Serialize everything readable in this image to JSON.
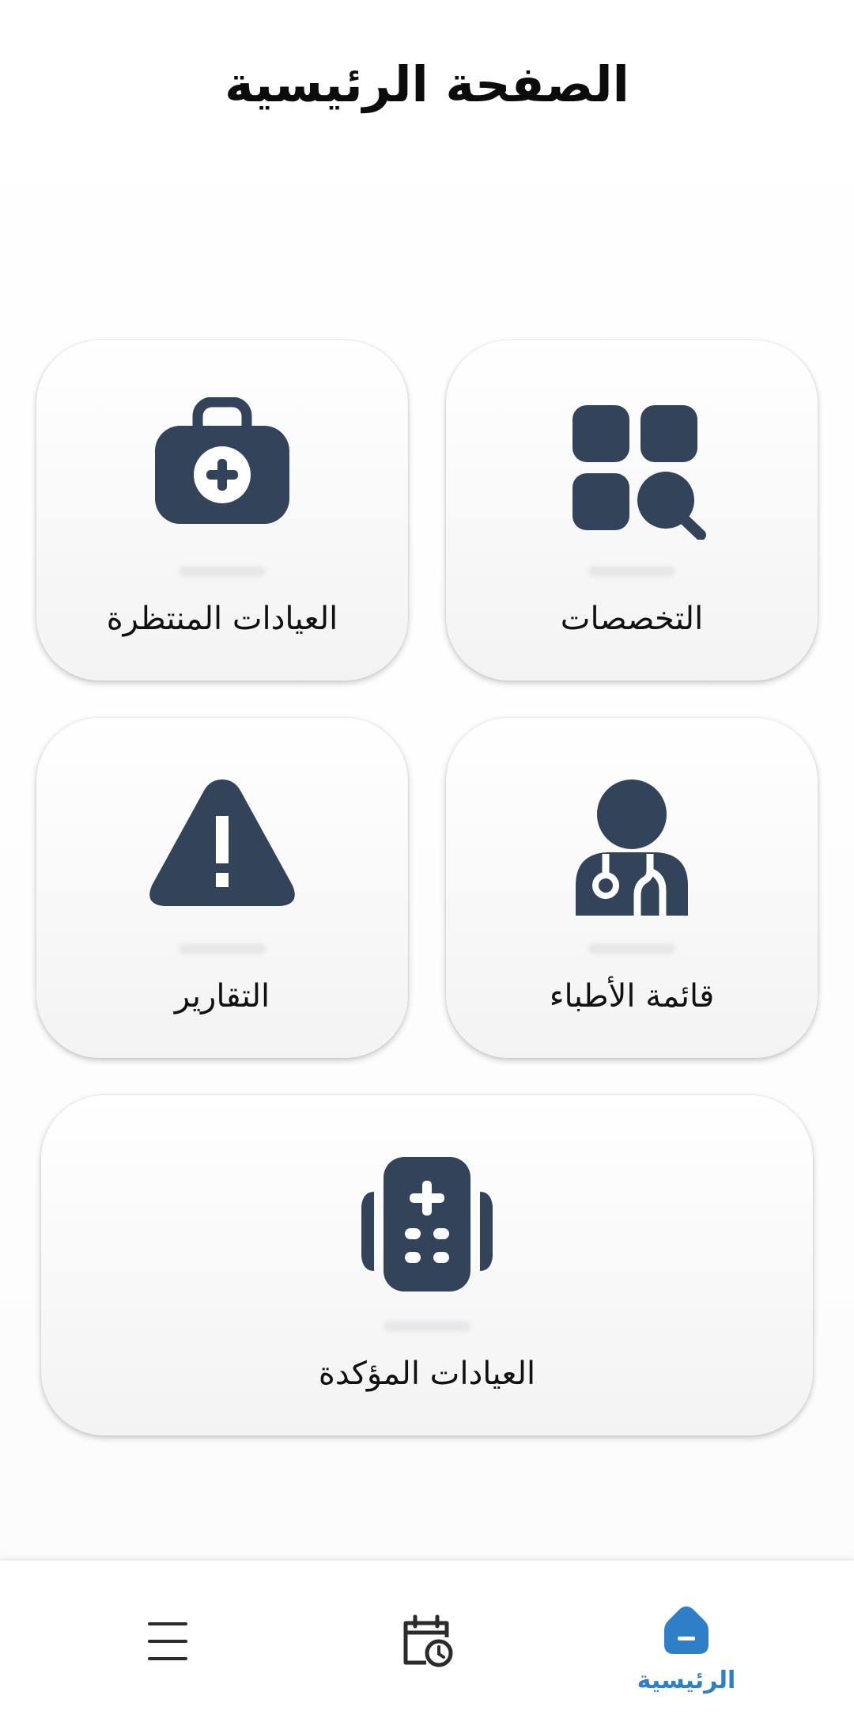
{
  "header": {
    "title": "الصفحة الرئيسية"
  },
  "cards": {
    "specialties": {
      "label": "التخصصات",
      "icon": "specialties-search-icon"
    },
    "pending_clinics": {
      "label": "العيادات المنتظرة",
      "icon": "medical-kit-icon"
    },
    "doctors_list": {
      "label": "قائمة الأطباء",
      "icon": "doctor-icon"
    },
    "reports": {
      "label": "التقارير",
      "icon": "warning-icon"
    },
    "confirmed_clinics": {
      "label": "العيادات المؤكدة",
      "icon": "medical-device-icon"
    }
  },
  "bottom_nav": {
    "items": [
      {
        "label": "",
        "icon": "menu-icon"
      },
      {
        "label": "",
        "icon": "calendar-clock-icon"
      },
      {
        "label": "الرئيسية",
        "icon": "home-icon",
        "active": true
      }
    ]
  },
  "colors": {
    "icon": "#33445a",
    "accent": "#2f7fc8",
    "text": "#111111"
  }
}
